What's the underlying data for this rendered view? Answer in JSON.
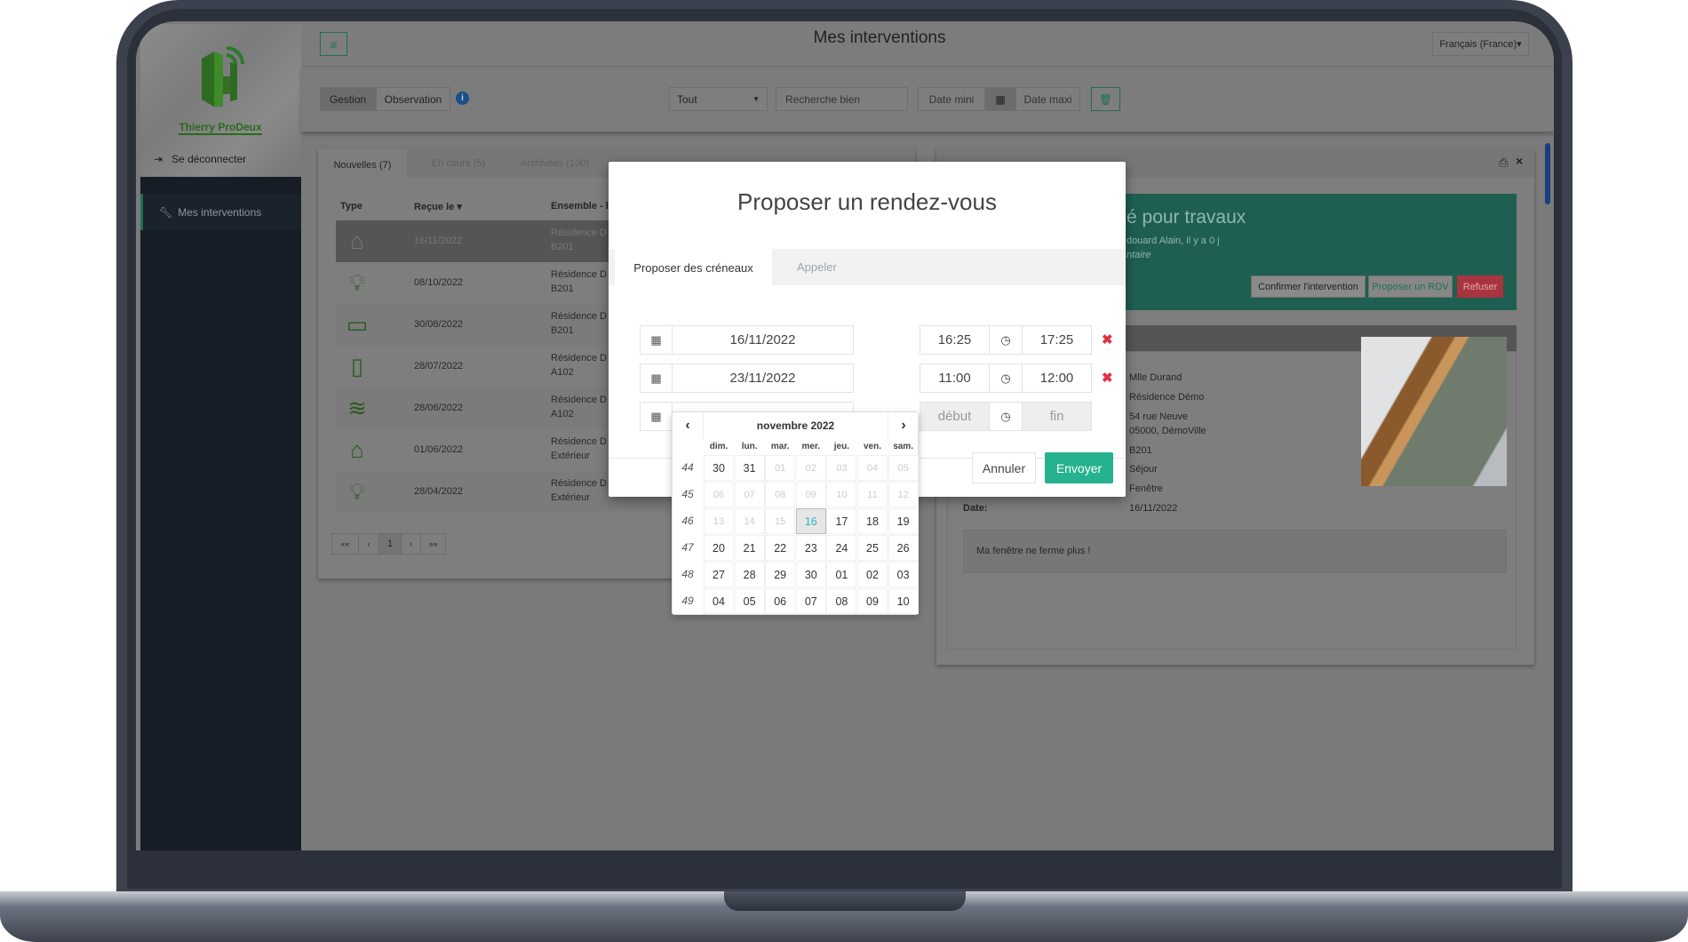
{
  "app": {
    "page_title": "Mes interventions",
    "language": "Français (France)"
  },
  "sidebar": {
    "user_name": "Thierry ProDeux",
    "logout": "Se déconnecter",
    "items": [
      {
        "label": "Mes interventions",
        "icon": "wrench-icon",
        "active": true
      }
    ]
  },
  "toolbar": {
    "mode_tabs": [
      "Gestion",
      "Observation"
    ],
    "active_mode": "Gestion",
    "filter_select": "Tout",
    "search_placeholder": "Recherche bien",
    "date_min_placeholder": "Date mini",
    "date_max_placeholder": "Date maxi"
  },
  "list": {
    "tabs": [
      "Nouvelles (7)",
      "En cours (5)",
      "Archivées (100)"
    ],
    "active_tab": "Nouvelles (7)",
    "columns": [
      "Type",
      "Reçue le",
      "Ensemble - l"
    ],
    "rows": [
      {
        "icon": "house-icon",
        "date": "16/11/2022",
        "ensemble": "Résidence D",
        "lot": "B201",
        "selected": true
      },
      {
        "icon": "electricity-icon",
        "date": "08/10/2022",
        "ensemble": "Résidence D",
        "lot": "B201"
      },
      {
        "icon": "paint-roller-icon",
        "date": "30/08/2022",
        "ensemble": "Résidence D",
        "lot": "B201"
      },
      {
        "icon": "door-icon",
        "date": "28/07/2022",
        "ensemble": "Résidence D",
        "lot": "A102"
      },
      {
        "icon": "wood-planks-icon",
        "date": "28/06/2022",
        "ensemble": "Résidence D",
        "lot": "A102"
      },
      {
        "icon": "house-icon",
        "date": "01/06/2022",
        "ensemble": "Résidence D",
        "lot": "Extérieur"
      },
      {
        "icon": "electricity-icon",
        "date": "28/04/2022",
        "ensemble": "Résidence D",
        "lot": "Extérieur"
      }
    ],
    "pagination": {
      "first": "««",
      "prev": "‹",
      "page": "1",
      "next": "›",
      "last": "»»"
    }
  },
  "detail": {
    "banner_title": "é pour travaux",
    "banner_sub": "douard Alain, il y a 0 j",
    "banner_note": "ntaire",
    "actions": {
      "confirm": "Confirmer l'intervention",
      "propose": "Proposer un RDV",
      "refuse": "Refuser"
    },
    "info": {
      "name": "Mlle Durand",
      "residence": "Résidence Démo",
      "address1": "54 rue Neuve",
      "address2": "05000, DémoVille",
      "lot": "B201",
      "room": "Séjour",
      "element": "Fenêtre",
      "date_label": "Date:",
      "date": "16/11/2022"
    },
    "comment": "Ma fenêtre ne ferme plus !"
  },
  "modal": {
    "title": "Proposer un rendez-vous",
    "tabs": [
      "Proposer des créneaux",
      "Appeler"
    ],
    "active_tab": "Proposer des créneaux",
    "slots": [
      {
        "date": "16/11/2022",
        "start": "16:25",
        "end": "17:25"
      },
      {
        "date": "23/11/2022",
        "start": "11:00",
        "end": "12:00"
      }
    ],
    "new_slot": {
      "date_placeholder": "Date",
      "start_placeholder": "début",
      "end_placeholder": "fin"
    },
    "cancel": "Annuler",
    "send": "Envoyer"
  },
  "calendar": {
    "month": "novembre 2022",
    "weekdays": [
      "dim.",
      "lun.",
      "mar.",
      "mer.",
      "jeu.",
      "ven.",
      "sam."
    ],
    "weeks": [
      {
        "n": "44",
        "days": [
          "30",
          "31",
          "01",
          "02",
          "03",
          "04",
          "05"
        ],
        "disabled": [
          0,
          0,
          1,
          1,
          1,
          1,
          1
        ]
      },
      {
        "n": "45",
        "days": [
          "06",
          "07",
          "08",
          "09",
          "10",
          "11",
          "12"
        ],
        "disabled": [
          1,
          1,
          1,
          1,
          1,
          1,
          1
        ]
      },
      {
        "n": "46",
        "days": [
          "13",
          "14",
          "15",
          "16",
          "17",
          "18",
          "19"
        ],
        "disabled": [
          1,
          1,
          1,
          0,
          0,
          0,
          0
        ]
      },
      {
        "n": "47",
        "days": [
          "20",
          "21",
          "22",
          "23",
          "24",
          "25",
          "26"
        ],
        "disabled": [
          0,
          0,
          0,
          0,
          0,
          0,
          0
        ]
      },
      {
        "n": "48",
        "days": [
          "27",
          "28",
          "29",
          "30",
          "01",
          "02",
          "03"
        ],
        "disabled": [
          0,
          0,
          0,
          0,
          0,
          0,
          0
        ]
      },
      {
        "n": "49",
        "days": [
          "04",
          "05",
          "06",
          "07",
          "08",
          "09",
          "10"
        ],
        "disabled": [
          0,
          0,
          0,
          0,
          0,
          0,
          0
        ]
      }
    ],
    "today": "16"
  },
  "colors": {
    "accent": "#26b28f",
    "danger": "#e0303f",
    "today": "#2bb5c8"
  }
}
